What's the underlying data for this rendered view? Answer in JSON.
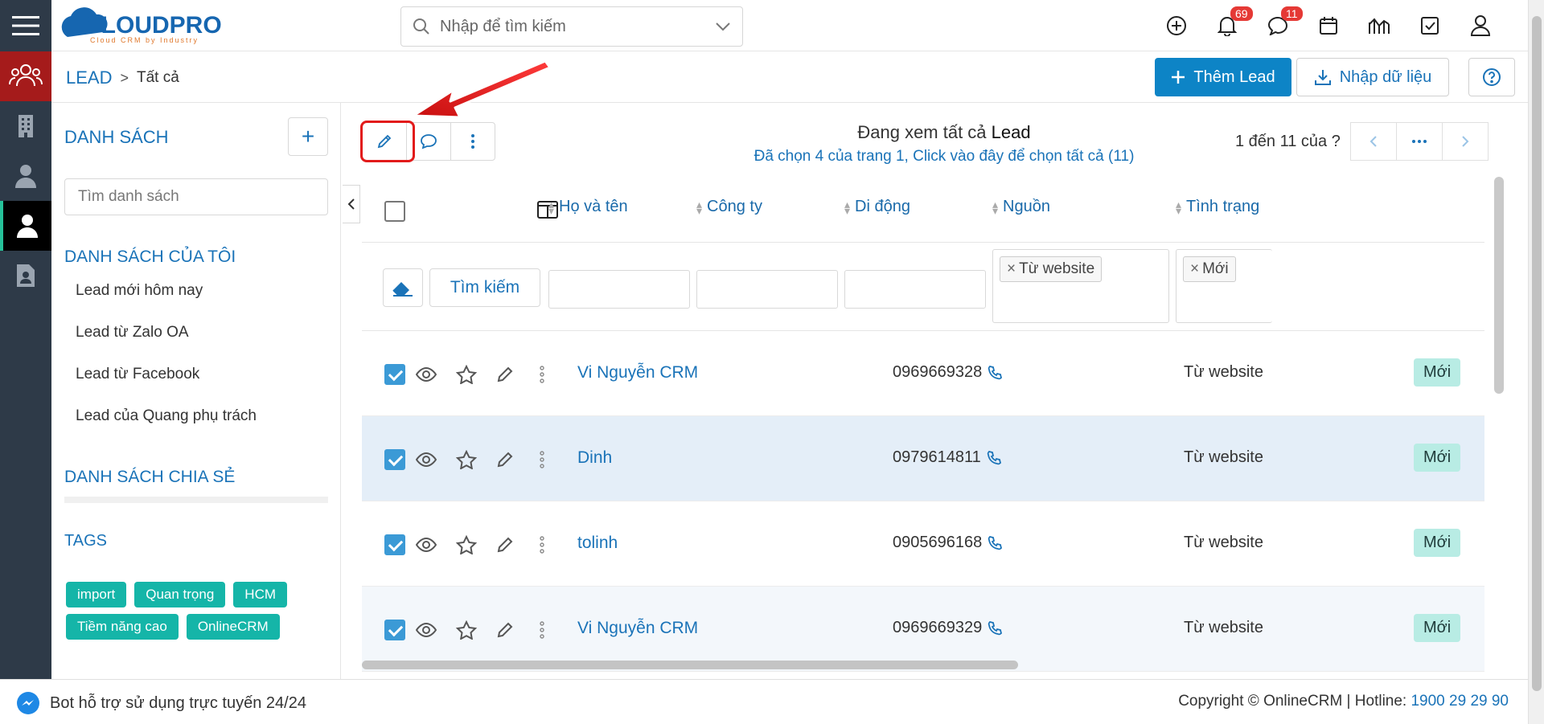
{
  "header": {
    "logo_text": "CLOUDPRO",
    "logo_tagline": "Cloud CRM by Industry",
    "search_placeholder": "Nhập để tìm kiếm",
    "notifications_count": "69",
    "messages_count": "11"
  },
  "breadcrumb": {
    "root": "LEAD",
    "separator": ">",
    "current": "Tất cả"
  },
  "actions": {
    "add_lead": "Thêm Lead",
    "import_data": "Nhập dữ liệu"
  },
  "sidebar": {
    "lists_title": "DANH SÁCH",
    "list_search_placeholder": "Tìm danh sách",
    "my_lists_title": "DANH SÁCH CỦA TÔI",
    "my_lists": [
      "Lead mới hôm nay",
      "Lead từ Zalo OA",
      "Lead từ Facebook",
      "Lead của Quang phụ trách"
    ],
    "shared_title": "DANH SÁCH CHIA SẺ",
    "tags_title": "TAGS",
    "tags": [
      "import",
      "Quan trọng",
      "HCM",
      "Tiềm năng cao",
      "OnlineCRM"
    ]
  },
  "view": {
    "viewing_prefix": "Đang xem tất cả",
    "viewing_module": "Lead",
    "selection_note": "Đã chọn 4 của trang 1, Click vào đây để chọn tất cả (11)",
    "pagination_text": "1 đến 11 của",
    "pagination_unknown": "?"
  },
  "table": {
    "columns": [
      "Họ và tên",
      "Công ty",
      "Di động",
      "Nguồn",
      "Tình trạng"
    ],
    "search_button": "Tìm kiếm",
    "filter_source_chip": "Từ website",
    "filter_status_chip": "Mới",
    "rows": [
      {
        "name": "Vi Nguyễn CRM",
        "company": "",
        "phone": "0969669328",
        "source": "Từ website",
        "status": "Mới",
        "checked": true
      },
      {
        "name": "Dinh",
        "company": "",
        "phone": "0979614811",
        "source": "Từ website",
        "status": "Mới",
        "checked": true
      },
      {
        "name": "tolinh",
        "company": "",
        "phone": "0905696168",
        "source": "Từ website",
        "status": "Mới",
        "checked": true
      },
      {
        "name": "Vi Nguyễn CRM",
        "company": "",
        "phone": "0969669329",
        "source": "Từ website",
        "status": "Mới",
        "checked": true
      }
    ]
  },
  "footer": {
    "bot_text": "Bot hỗ trợ sử dụng trực tuyến 24/24",
    "copyright": "Copyright © OnlineCRM",
    "hotline_label": "Hotline:",
    "hotline_number": "1900 29 29 90"
  },
  "colors": {
    "primary": "#0d84c6",
    "tag": "#15b5a8",
    "status_bg": "#b8ece4",
    "rail": "#2e3a48",
    "annotation": "#e21b1b"
  }
}
